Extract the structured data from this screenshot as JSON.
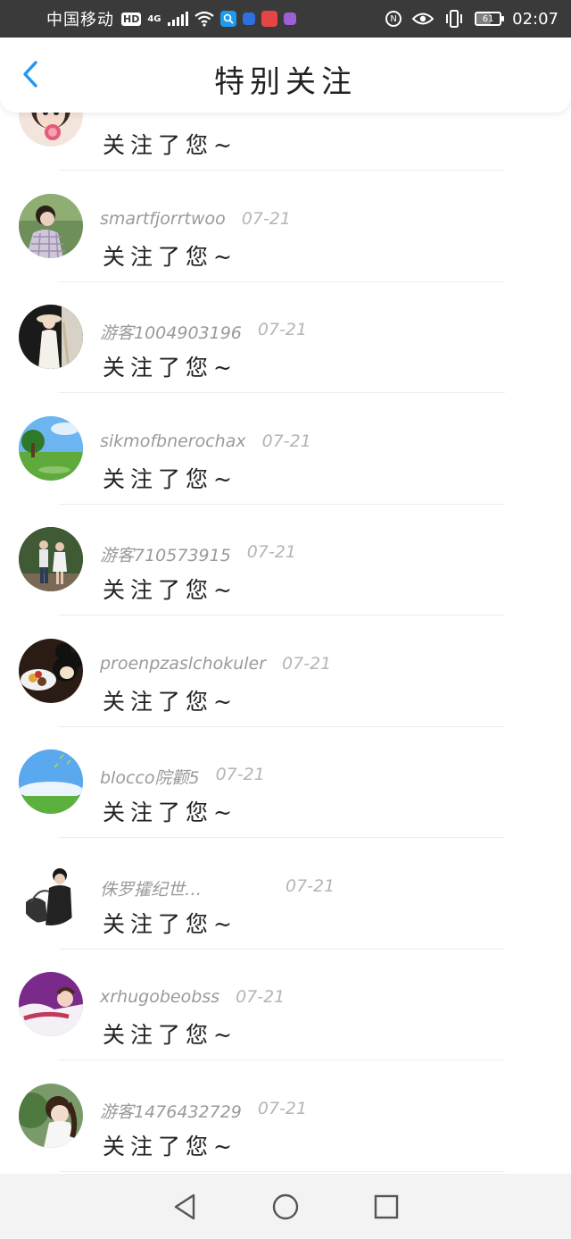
{
  "status_bar": {
    "carrier": "中国移动",
    "hd": "HD",
    "network": "4G",
    "battery": "61",
    "battery_level_percent": 61,
    "time": "02:07"
  },
  "header": {
    "title": "特别关注"
  },
  "list": {
    "items": [
      {
        "name": "",
        "date": "",
        "message": "关注了您~",
        "avatar": "girl-lollipop"
      },
      {
        "name": "smartfjorrtwoo",
        "date": "07-21",
        "message": "关注了您~",
        "avatar": "girl-plaid"
      },
      {
        "name": "游客1004903196",
        "date": "07-21",
        "message": "关注了您~",
        "avatar": "girl-hat"
      },
      {
        "name": "sikmofbnerochax",
        "date": "07-21",
        "message": "关注了您~",
        "avatar": "landscape-tree"
      },
      {
        "name": "游客710573915",
        "date": "07-21",
        "message": "关注了您~",
        "avatar": "couple"
      },
      {
        "name": "proenpzaslchokuler",
        "date": "07-21",
        "message": "关注了您~",
        "avatar": "mickey"
      },
      {
        "name": "blocco院颧5",
        "date": "07-21",
        "message": "关注了您~",
        "avatar": "sky-grass"
      },
      {
        "name": "侏罗攉纪世…",
        "date": "07-21",
        "message": "关注了您~",
        "avatar": "man-bag"
      },
      {
        "name": "xrhugobeobss",
        "date": "07-21",
        "message": "关注了您~",
        "avatar": "woman-purple"
      },
      {
        "name": "游客1476432729",
        "date": "07-21",
        "message": "关注了您~",
        "avatar": "girl-green"
      }
    ]
  },
  "colors": {
    "accent": "#2196f3",
    "status_bar_bg": "#3a3a3a",
    "nav_bar_bg": "#f3f3f3"
  }
}
